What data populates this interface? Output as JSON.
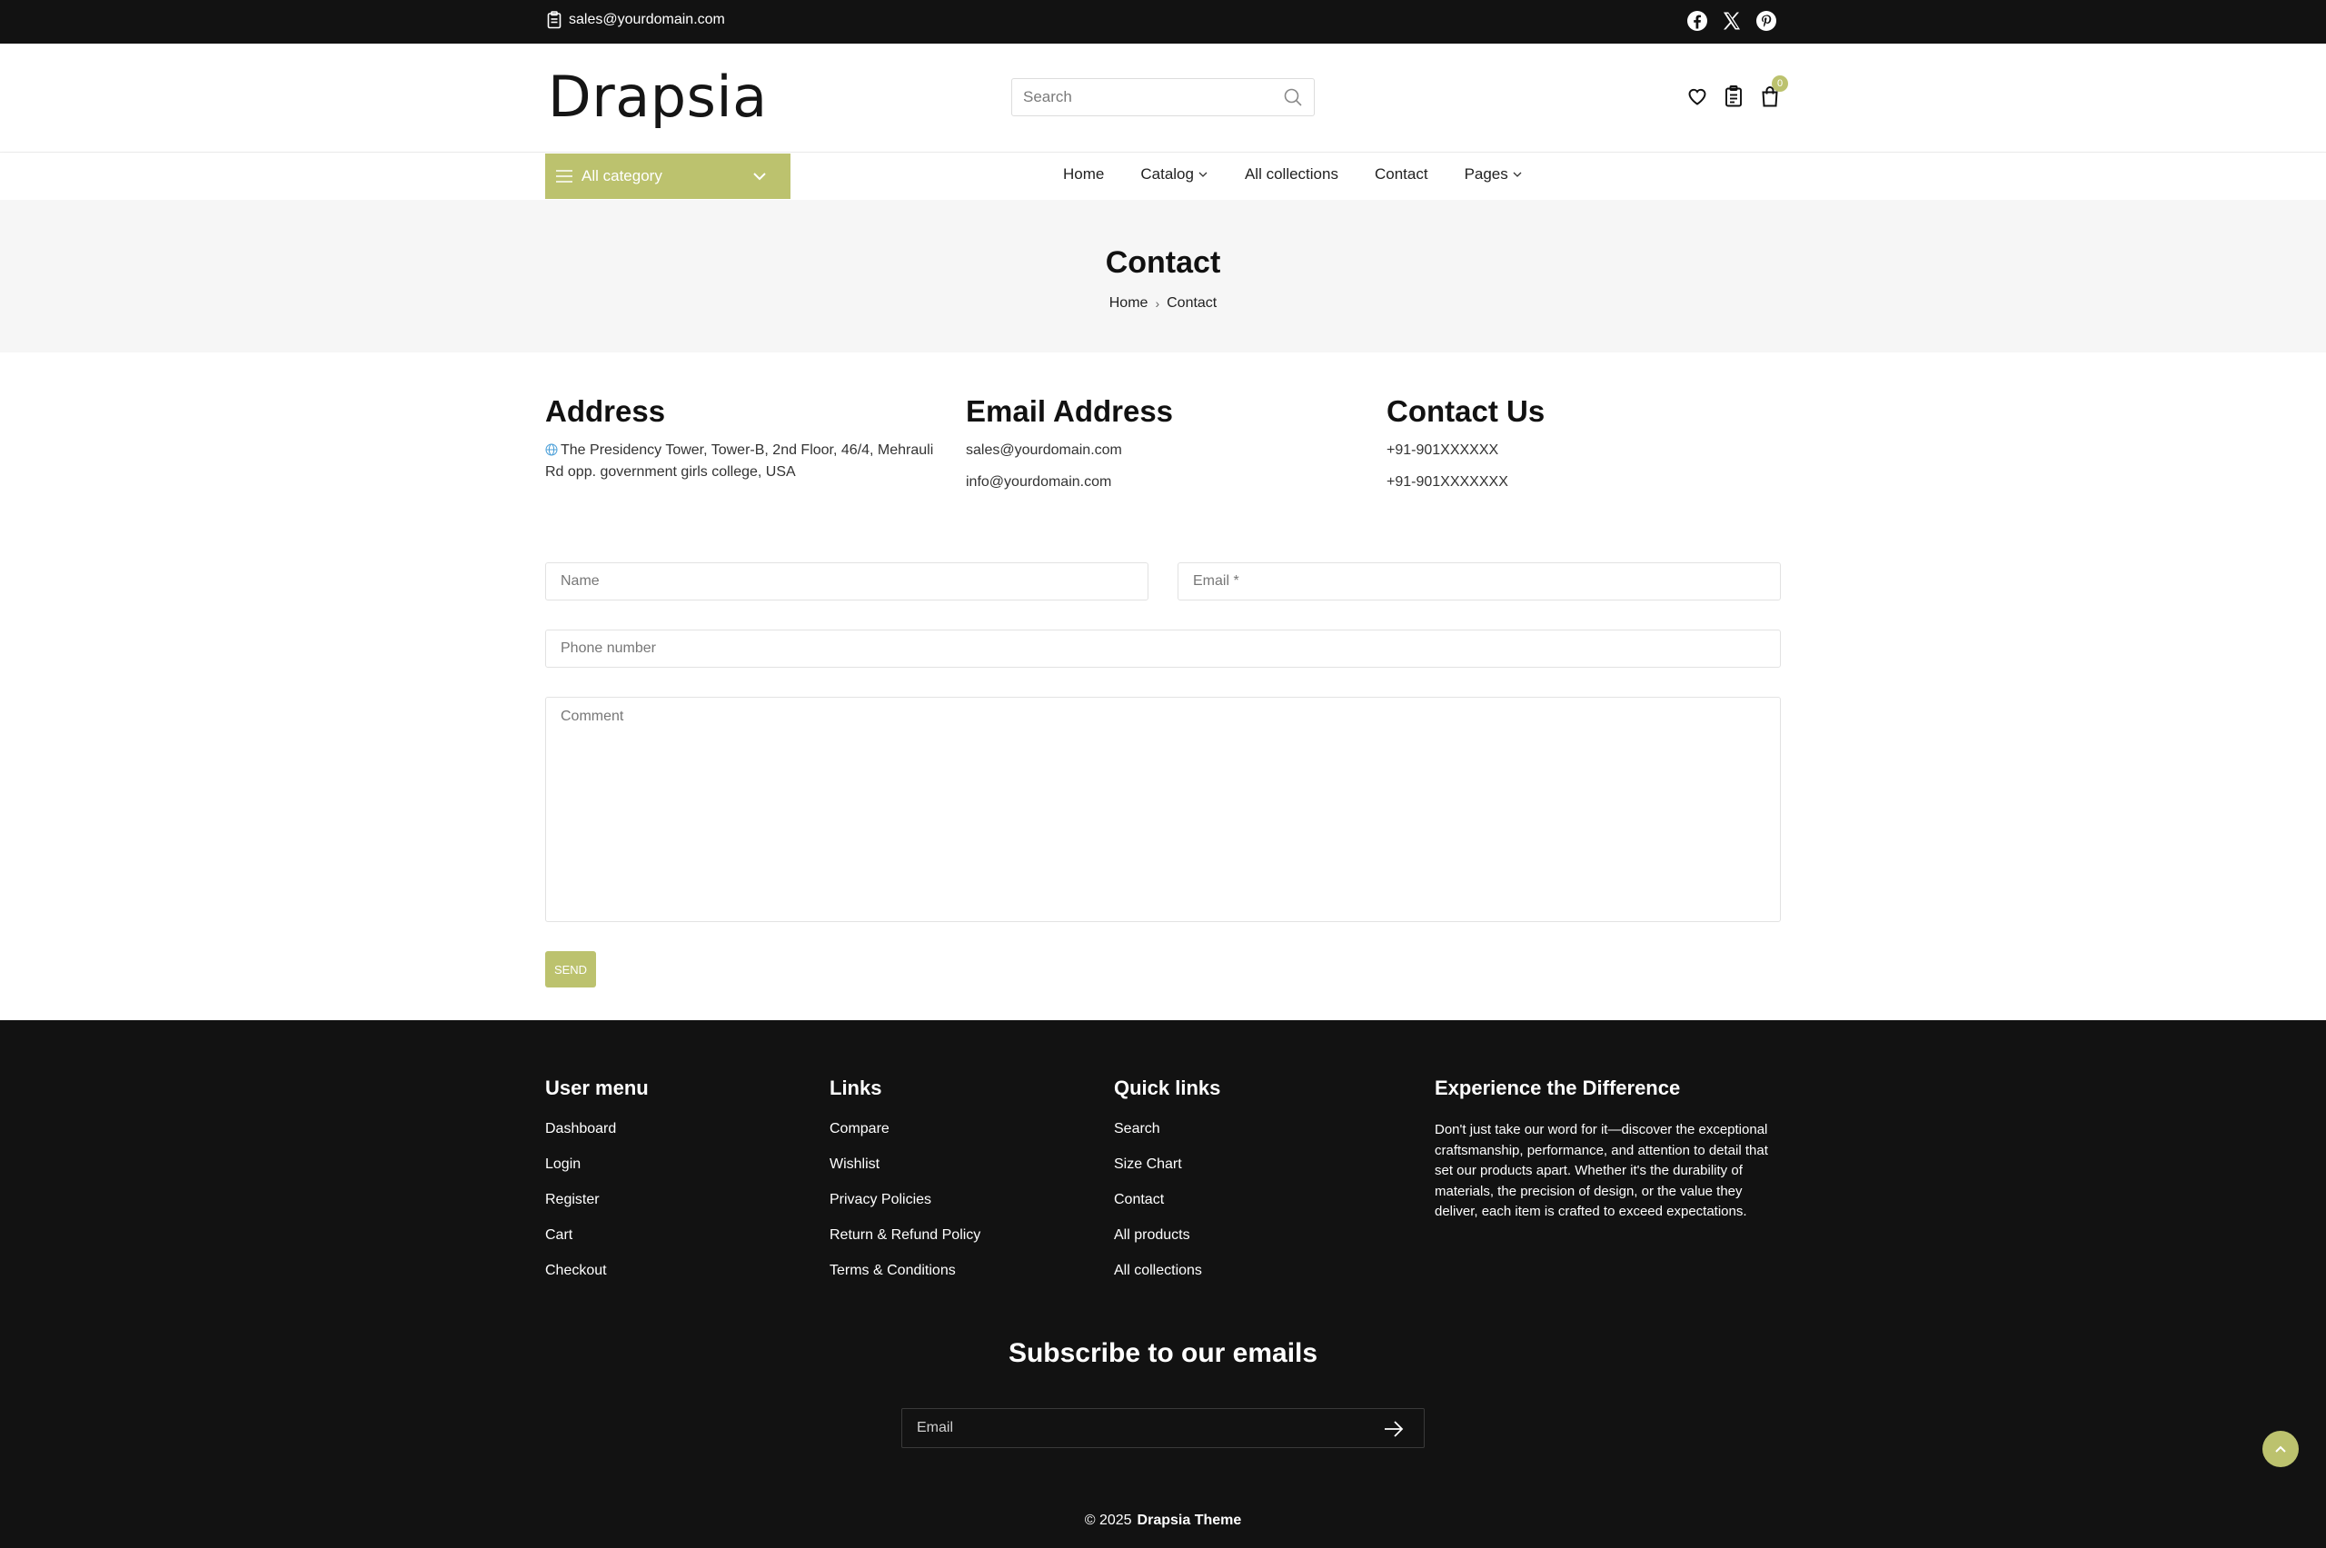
{
  "topbar": {
    "email": "sales@yourdomain.com",
    "icons": [
      "clipboard-icon",
      "facebook-icon",
      "x-twitter-icon",
      "pinterest-icon"
    ]
  },
  "header": {
    "logo": "Drapsia",
    "search_placeholder": "Search",
    "cart_count": "0"
  },
  "nav": {
    "all_category": "All category",
    "links": [
      "Home",
      "Catalog",
      "All collections",
      "Contact",
      "Pages"
    ]
  },
  "page": {
    "title": "Contact",
    "breadcrumb": [
      "Home",
      "Contact"
    ]
  },
  "contact_info": {
    "address_title": "Address",
    "address_line1": "The Presidency Tower, Tower-B, 2nd Floor, 46/4, Mehrauli",
    "address_line2": "Rd opp. government girls college, USA",
    "email_title": "Email Address",
    "emails": [
      "sales@yourdomain.com",
      "info@yourdomain.com"
    ],
    "contact_title": "Contact Us",
    "phones": [
      "+91-901XXXXXX",
      "+91-901XXXXXXX"
    ]
  },
  "form": {
    "name_placeholder": "Name",
    "email_placeholder": "Email *",
    "phone_placeholder": "Phone number",
    "comment_placeholder": "Comment",
    "send_label": "SEND"
  },
  "footer": {
    "user_menu": {
      "title": "User menu",
      "items": [
        "Dashboard",
        "Login",
        "Register",
        "Cart",
        "Checkout"
      ]
    },
    "links": {
      "title": "Links",
      "items": [
        "Compare",
        "Wishlist",
        "Privacy Policies",
        "Return & Refund Policy",
        "Terms & Conditions"
      ]
    },
    "quick_links": {
      "title": "Quick links",
      "items": [
        "Search",
        "Size Chart",
        "Contact",
        "All products",
        "All collections"
      ]
    },
    "experience": {
      "title": "Experience the Difference",
      "text": "Don't just take our word for it—discover the exceptional craftsmanship, performance, and attention to detail that set our products apart. Whether it's the durability of materials, the precision of design, or the value they deliver, each item is crafted to exceed expectations."
    },
    "subscribe_title": "Subscribe to our emails",
    "subscribe_placeholder": "Email",
    "copyright_prefix": "© 2025",
    "copyright_brand": "Drapsia Theme"
  },
  "colors": {
    "accent": "#bcc26e",
    "dark": "#121212",
    "page_head_bg": "#f6f6f6"
  }
}
